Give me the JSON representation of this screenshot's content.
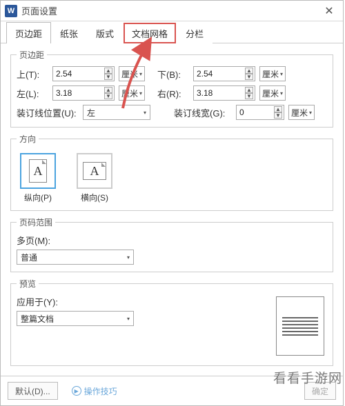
{
  "window": {
    "title": "页面设置"
  },
  "tabs": [
    "页边距",
    "纸张",
    "版式",
    "文档网格",
    "分栏"
  ],
  "active_tab_index": 0,
  "highlight_tab_index": 3,
  "margins": {
    "legend": "页边距",
    "top_label": "上(T):",
    "top_value": "2.54",
    "bottom_label": "下(B):",
    "bottom_value": "2.54",
    "left_label": "左(L):",
    "left_value": "3.18",
    "right_label": "右(R):",
    "right_value": "3.18",
    "gutter_pos_label": "装订线位置(U):",
    "gutter_pos_value": "左",
    "gutter_width_label": "装订线宽(G):",
    "gutter_width_value": "0",
    "unit": "厘米"
  },
  "orientation": {
    "legend": "方向",
    "portrait_label": "纵向(P)",
    "landscape_label": "横向(S)",
    "selected": "portrait"
  },
  "page_range": {
    "legend": "页码范围",
    "multi_label": "多页(M):",
    "multi_value": "普通"
  },
  "preview": {
    "legend": "预览",
    "apply_label": "应用于(Y):",
    "apply_value": "整篇文档"
  },
  "footer": {
    "default_btn": "默认(D)...",
    "tips_btn": "操作技巧",
    "ok_btn": "确定"
  },
  "watermark": "看看手游网"
}
